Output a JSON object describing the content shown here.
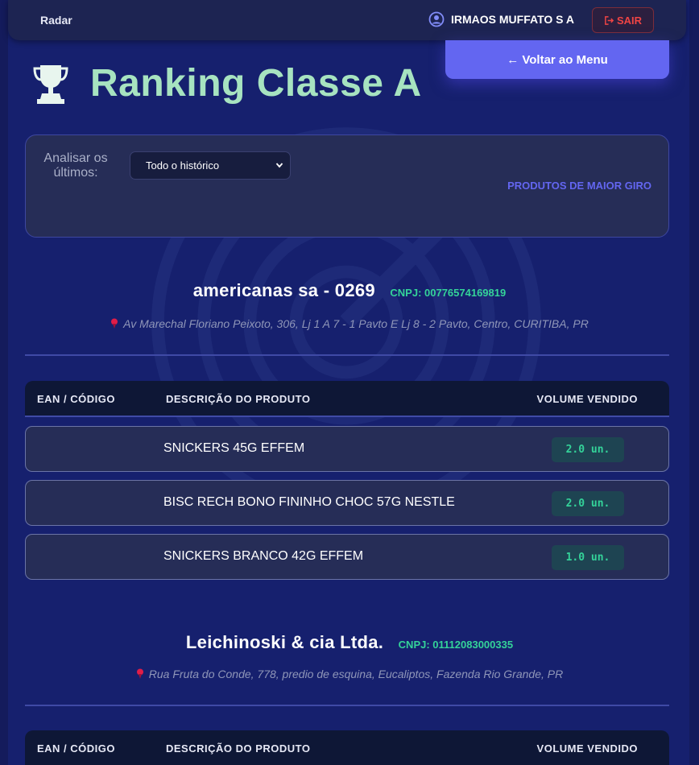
{
  "navbar": {
    "brand": "Radar",
    "user_name": "IRMAOS MUFFATO S A",
    "logout_label": "SAIR"
  },
  "back_button_label": "← Voltar ao Menu",
  "page_title": "Ranking Classe A",
  "filter": {
    "label": "Analisar os últimos:",
    "selected_option": "Todo o histórico",
    "section_label": "PRODUTOS DE MAIOR GIRO"
  },
  "table_headers": {
    "ean": "EAN / CÓDIGO",
    "description": "DESCRIÇÃO DO PRODUTO",
    "volume": "VOLUME VENDIDO"
  },
  "stores": [
    {
      "name": "americanas sa - 0269",
      "cnpj": "CNPJ: 00776574169819",
      "address": "Av Marechal Floriano Peixoto, 306, Lj 1 A 7 - 1 Pavto E Lj 8 - 2 Pavto, Centro, CURITIBA, PR",
      "products": [
        {
          "ean": "",
          "description": "SNICKERS 45G EFFEM",
          "volume": "2.0 un."
        },
        {
          "ean": "",
          "description": "BISC RECH BONO FININHO CHOC 57G NESTLE",
          "volume": "2.0 un."
        },
        {
          "ean": "",
          "description": "SNICKERS BRANCO 42G EFFEM",
          "volume": "1.0 un."
        }
      ]
    },
    {
      "name": "Leichinoski & cia Ltda.",
      "cnpj": "CNPJ: 01112083000335",
      "address": "Rua Fruta do Conde, 778, predio de esquina, Eucaliptos, Fazenda Rio Grande, PR",
      "products": []
    }
  ],
  "colors": {
    "background": "#16206e",
    "accent": "#6366f1",
    "title": "#a7e3c0",
    "success": "#34d399",
    "danger": "#ef4444"
  },
  "icons": {
    "user": "user-circle-icon",
    "logout": "logout-icon",
    "trophy": "trophy-icon",
    "pin": "map-pin-icon",
    "select": "chevron-down-icon"
  }
}
